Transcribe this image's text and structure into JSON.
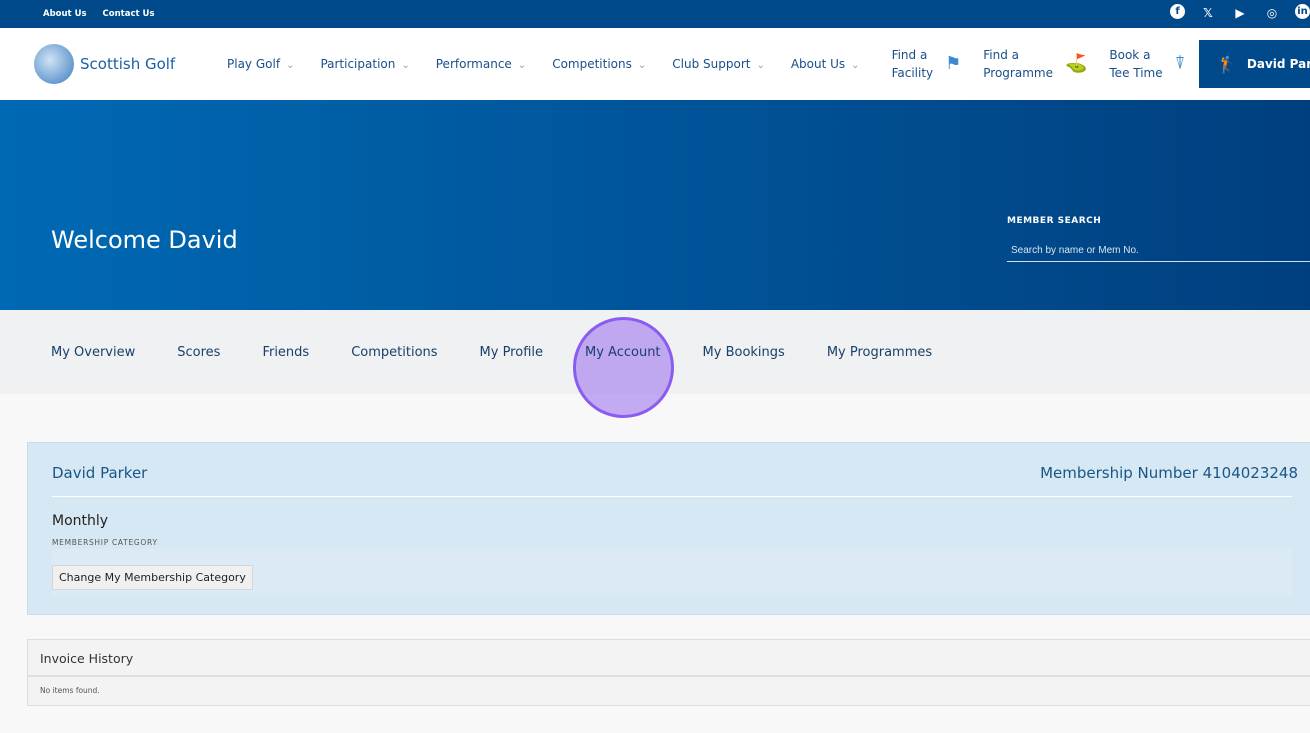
{
  "topbar": {
    "links": [
      "About Us",
      "Contact Us"
    ],
    "social": [
      "facebook-icon",
      "x-icon",
      "youtube-icon",
      "instagram-icon",
      "linkedin-icon"
    ]
  },
  "header": {
    "logo": "Scottish Golf",
    "nav": [
      "Play Golf",
      "Participation",
      "Performance",
      "Competitions",
      "Club Support",
      "About Us"
    ],
    "quick": [
      {
        "l1": "Find a",
        "l2": "Facility"
      },
      {
        "l1": "Find a",
        "l2": "Programme"
      },
      {
        "l1": "Book a",
        "l2": "Tee Time"
      }
    ],
    "user": "David Parker"
  },
  "hero": {
    "welcome": "Welcome David",
    "search_label": "MEMBER SEARCH",
    "search_placeholder": "Search by name or Mem No."
  },
  "tabs": [
    "My Overview",
    "Scores",
    "Friends",
    "Competitions",
    "My Profile",
    "My Account",
    "My Bookings",
    "My Programmes"
  ],
  "account": {
    "name": "David Parker",
    "membership_number": "Membership Number 4104023248",
    "category": "Monthly",
    "category_label": "MEMBERSHIP CATEGORY",
    "change_button": "Change My Membership Category"
  },
  "invoices": {
    "title": "Invoice History",
    "empty": "No items found."
  }
}
